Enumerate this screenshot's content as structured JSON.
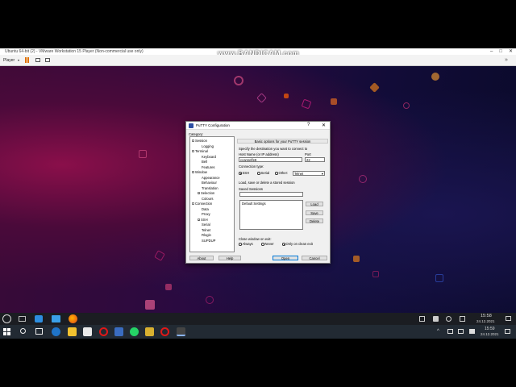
{
  "vmware": {
    "title": "Ubuntu 64-bit (2) - VMware Workstation 15 Player (Non-commercial use only)",
    "player_menu": "Player",
    "watermark": "www.BANDICAM.com"
  },
  "putty": {
    "title": "PuTTY Configuration",
    "help": "?",
    "close": "✕",
    "category_label": "Category:",
    "tree": [
      {
        "label": "Session",
        "level": 0,
        "expand": "-"
      },
      {
        "label": "Logging",
        "level": 2
      },
      {
        "label": "Terminal",
        "level": 0,
        "expand": "-"
      },
      {
        "label": "Keyboard",
        "level": 2
      },
      {
        "label": "Bell",
        "level": 2
      },
      {
        "label": "Features",
        "level": 2
      },
      {
        "label": "Window",
        "level": 0,
        "expand": "-"
      },
      {
        "label": "Appearance",
        "level": 2
      },
      {
        "label": "Behaviour",
        "level": 2
      },
      {
        "label": "Translation",
        "level": 2
      },
      {
        "label": "Selection",
        "level": 1,
        "expand": "+"
      },
      {
        "label": "Colours",
        "level": 2
      },
      {
        "label": "Connection",
        "level": 0,
        "expand": "-"
      },
      {
        "label": "Data",
        "level": 2
      },
      {
        "label": "Proxy",
        "level": 2
      },
      {
        "label": "SSH",
        "level": 1,
        "expand": "+"
      },
      {
        "label": "Serial",
        "level": 2
      },
      {
        "label": "Telnet",
        "level": 2
      },
      {
        "label": "Rlogin",
        "level": 2
      },
      {
        "label": "SUPDUP",
        "level": 2
      }
    ],
    "section_header": "Basic options for your PuTTY session",
    "specify_label": "Specify the destination you want to connect to",
    "host_label": "Host Name (or IP address)",
    "port_label": "Port",
    "host_value": "ccannelfe8",
    "port_value": "22",
    "conn_type_label": "Connection type:",
    "conn_types": [
      "SSH",
      "Serial",
      "Other:"
    ],
    "other_select": "Telnet",
    "load_save_label": "Load, save or delete a stored session",
    "saved_sessions_label": "Saved Sessions",
    "saved_session_value": "",
    "sessions": [
      "Default Settings"
    ],
    "load_btn": "Load",
    "save_btn": "Save",
    "delete_btn": "Delete",
    "close_exit_label": "Close window on exit:",
    "close_exit_options": [
      "Always",
      "Never",
      "Only on clean exit"
    ],
    "about_btn": "About",
    "help_btn": "Help",
    "open_btn": "Open",
    "cancel_btn": "Cancel"
  },
  "guest_taskbar": {
    "time": "15:58",
    "date": "24.12.2021"
  },
  "host_taskbar": {
    "time": "15:59",
    "date": "24.12.2021"
  }
}
